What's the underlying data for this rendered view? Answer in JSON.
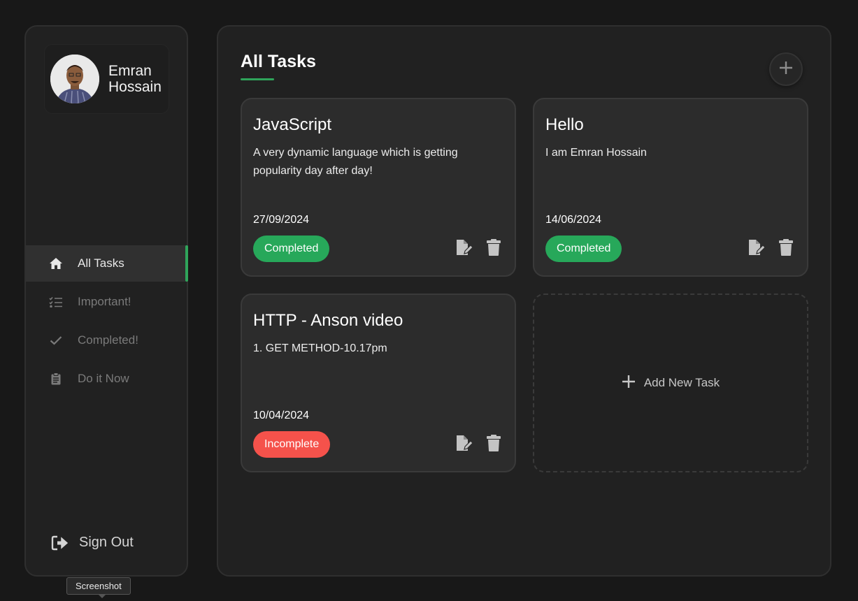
{
  "user": {
    "name": "Emran Hossain"
  },
  "nav": {
    "items": [
      {
        "label": "All Tasks",
        "icon": "home-icon",
        "active": true
      },
      {
        "label": "Important!",
        "icon": "list-check-icon",
        "active": false
      },
      {
        "label": "Completed!",
        "icon": "check-icon",
        "active": false
      },
      {
        "label": "Do it Now",
        "icon": "clipboard-icon",
        "active": false
      }
    ],
    "signout_label": "Sign Out"
  },
  "tooltip": "Screenshot",
  "main": {
    "title": "All Tasks",
    "add_new_label": "Add New Task"
  },
  "tasks": [
    {
      "title": "JavaScript",
      "description": "A very dynamic language which is getting popularity day after day!",
      "date": "27/09/2024",
      "status": "Completed",
      "status_color": "#27a85a"
    },
    {
      "title": "Hello",
      "description": "I am Emran Hossain",
      "date": "14/06/2024",
      "status": "Completed",
      "status_color": "#27a85a"
    },
    {
      "title": "HTTP - Anson video",
      "description": "1. GET METHOD-10.17pm",
      "date": "10/04/2024",
      "status": "Incomplete",
      "status_color": "#f5524b"
    }
  ],
  "colors": {
    "accent": "#2fa45a",
    "completed": "#27a85a",
    "incomplete": "#f5524b",
    "panel": "#212121",
    "card": "#2c2c2c"
  }
}
